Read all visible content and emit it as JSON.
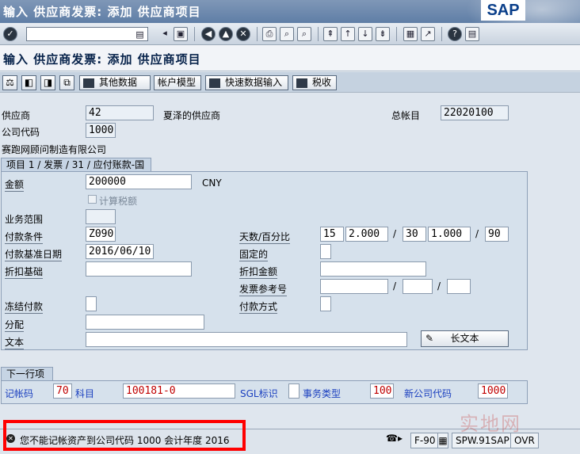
{
  "window": {
    "title": "输入 供应商发票: 添加 供应商项目",
    "logo": "SAP"
  },
  "screen_title": "输入 供应商发票: 添加 供应商项目",
  "app_toolbar": {
    "other_data": "其他数据",
    "account_model": "帐户模型",
    "fast_data_entry": "快速数据输入",
    "tax": "税收"
  },
  "header": {
    "vendor_label": "供应商",
    "vendor_value": "42",
    "vendor_name": "夏泽的供应商",
    "gl_label": "总帐目",
    "gl_value": "22020100",
    "company_label": "公司代码",
    "company_value": "1000",
    "company_name": "赛跑网顾问制造有限公司"
  },
  "item_panel": {
    "tab_title": "项目 1 / 发票 / 31 / 应付账款-国内",
    "amount_label": "金额",
    "amount_value": "200000",
    "currency": "CNY",
    "calc_tax_label": "计算税额",
    "business_area_label": "业务范围",
    "payment_terms_label": "付款条件",
    "payment_terms_value": "Z090",
    "days_pct_label": "天数/百分比",
    "days1": "15",
    "pct1": "2.000",
    "days2": "30",
    "pct2": "1.000",
    "days3": "90",
    "baseline_label": "付款基准日期",
    "baseline_value": "2016/06/10",
    "fixed_label": "固定的",
    "discount_base_label": "折扣基础",
    "discount_amount_label": "折扣金额",
    "invoice_ref_label": "发票参考号",
    "block_label": "冻结付款",
    "payment_method_label": "付款方式",
    "assignment_label": "分配",
    "text_label": "文本",
    "long_text_button": "长文本"
  },
  "next_item": {
    "title": "下一行项目",
    "posting_key_label": "记帐码",
    "posting_key_value": "70",
    "account_label": "科目",
    "account_value": "100181-0",
    "sgl_label": "SGL标识",
    "trans_type_label": "事务类型",
    "trans_type_value": "100",
    "new_company_label": "新公司代码",
    "new_company_value": "1000"
  },
  "status": {
    "message": "您不能记帐资产到公司代码 1000 会计年度 2016",
    "transaction": "F-90",
    "system": "SPW.91SAP",
    "mode": "OVR"
  },
  "watermark": "实地网"
}
